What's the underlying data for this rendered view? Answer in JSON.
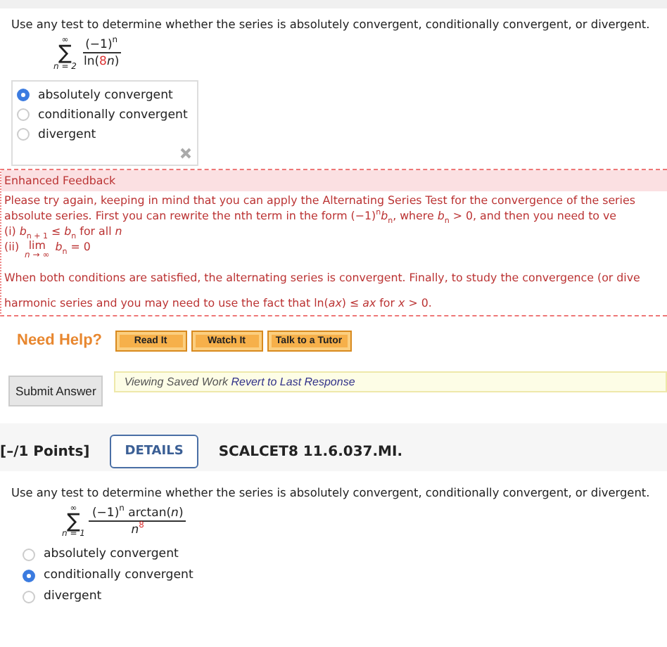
{
  "question_1": {
    "prompt": "Use any test to determine whether the series is absolutely convergent, conditionally convergent, or divergent.",
    "series": {
      "upper": "∞",
      "sigma": "∑",
      "lower": "n = 2",
      "numerator": [
        "(−1)$^{n}$"
      ],
      "denominator": [
        {
          "text": "ln(",
          "highlight": false
        },
        {
          "text": "8",
          "highlight": true
        },
        {
          "text": "*n*)",
          "highlight": false
        }
      ]
    },
    "options": [
      {
        "label": "absolutely convergent",
        "selected": true
      },
      {
        "label": "conditionally convergent",
        "selected": false
      },
      {
        "label": "divergent",
        "selected": false
      }
    ]
  },
  "feedback": {
    "title": "Enhanced Feedback",
    "intro": [
      "Please try again, keeping in mind that you can apply the Alternating Series Test for the convergence of the series",
      "absolute series. First you can rewrite the nth term in the form  (−1)$^{n}$*b*$_{n}$,  where  *b*$_{n}$ > 0,  and then you need to ve"
    ],
    "condition_1": "(i)  *b*$_{n + 1}$ ≤ *b*$_{n}$  for all *n*",
    "condition_2": {
      "label": "(ii)",
      "lim": "lim",
      "under": "*n* → ∞",
      "expr": "*b*$_{n}$ = 0"
    },
    "closing": [
      "When both conditions are satisfied, the alternating series is convergent. Finally, to study the convergence (or dive",
      "harmonic series and you may need to use the fact that  ln(*ax*) ≤ *ax*  for  *x* > 0."
    ]
  },
  "help": {
    "label": "Need Help?",
    "buttons": [
      "Read It",
      "Watch It",
      "Talk to a Tutor"
    ]
  },
  "submit": "Submit Answer",
  "notice": {
    "text": "Viewing Saved Work",
    "link": "Revert to Last Response"
  },
  "question_2": {
    "points": "[–/1 Points]",
    "details": "DETAILS",
    "code": "SCALCET8 11.6.037.MI.",
    "prompt": "Use any test to determine whether the series is absolutely convergent, conditionally convergent, or divergent.",
    "series": {
      "upper": "∞",
      "sigma": "∑",
      "lower": "n = 1",
      "numerator": [
        "(−1)$^{n}$ arctan(*n*)"
      ],
      "denominator": [
        {
          "text": "*n*",
          "highlight": false
        },
        {
          "text": "$^{8}$",
          "highlight": true
        }
      ]
    },
    "options": [
      {
        "label": "absolutely convergent",
        "selected": false
      },
      {
        "label": "conditionally convergent",
        "selected": true
      },
      {
        "label": "divergent",
        "selected": false
      }
    ]
  }
}
